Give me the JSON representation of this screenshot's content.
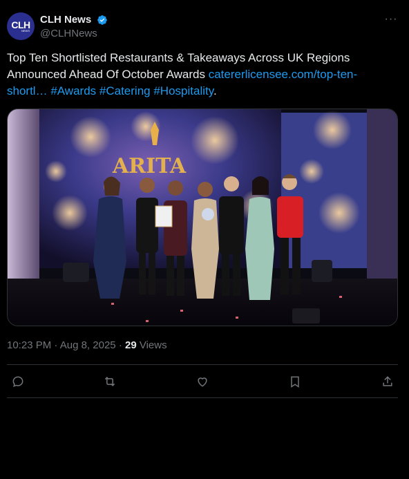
{
  "account": {
    "display_name": "CLH News",
    "handle": "@CLHNews",
    "avatar_text": "CLH",
    "avatar_subtext": "NEWS",
    "verified": true
  },
  "tweet": {
    "text": "Top Ten Shortlisted Restaurants & Takeaways Across UK Regions Announced Ahead Of October Awards ",
    "link": "catererlicensee.com/top-ten-shortl…",
    "hashtags": [
      "#Awards",
      "#Catering",
      "#Hospitality"
    ],
    "trailing": "."
  },
  "media": {
    "banner_text": "ARITA",
    "icon": "award-ceremony-photo"
  },
  "meta": {
    "time": "10:23 PM",
    "separator": "·",
    "date": "Aug 8, 2025",
    "views_count": "29",
    "views_label": "Views"
  },
  "actions": {
    "reply_icon": "reply-icon",
    "retweet_icon": "retweet-icon",
    "like_icon": "like-icon",
    "bookmark_icon": "bookmark-icon",
    "share_icon": "share-icon"
  },
  "colors": {
    "background": "#000000",
    "link": "#1d9bf0",
    "muted": "#71767b",
    "text": "#e7e9ea",
    "verified": "#1d9bf0",
    "avatar": "#2b2f8f"
  }
}
